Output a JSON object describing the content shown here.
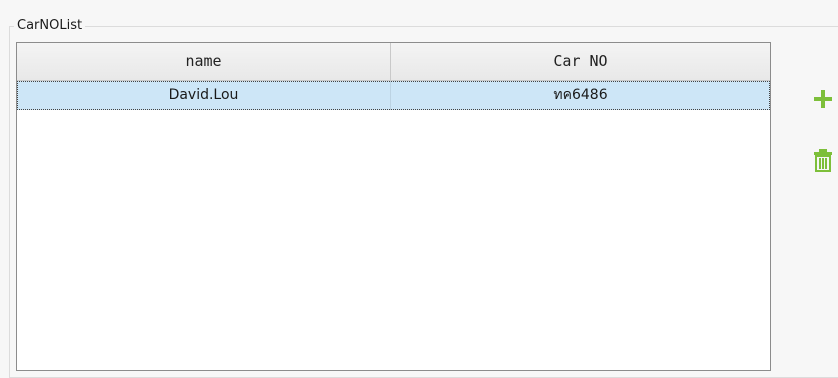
{
  "group": {
    "title": "CarNOList"
  },
  "table": {
    "columns": [
      "name",
      "Car NO"
    ],
    "rows": [
      {
        "name": "David.Lou",
        "car_no": "ทค6486",
        "selected": true
      }
    ]
  },
  "toolbar": {
    "add_icon": "plus-icon",
    "delete_icon": "trash-icon",
    "accent_color": "#7dbf3a"
  }
}
